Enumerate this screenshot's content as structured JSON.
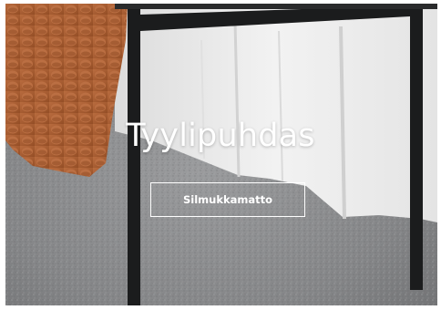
{
  "hero": {
    "title": "Tyylipuhdas",
    "button_label": "Silmukkamatto"
  },
  "colors": {
    "carpet": "#8a8b8d",
    "wall": "#ececec",
    "chair_frame": "#1b1c1d",
    "knit_throw": "#b8673a",
    "text": "#ffffff"
  }
}
